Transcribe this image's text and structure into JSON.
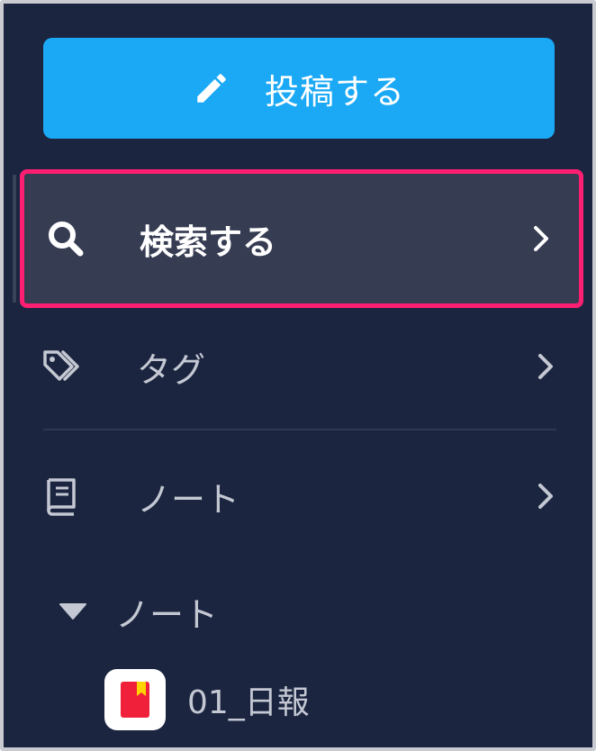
{
  "sidebar": {
    "post_button": {
      "label": "投稿する",
      "icon": "pencil-icon"
    },
    "items": [
      {
        "label": "検索する",
        "icon": "search-icon",
        "selected": true
      },
      {
        "label": "タグ",
        "icon": "tag-icon"
      },
      {
        "label": "ノート",
        "icon": "book-icon"
      }
    ],
    "notes_section": {
      "label": "ノート",
      "expanded": true,
      "entries": [
        {
          "label": "01_日報",
          "icon": "notebook-icon",
          "color": "#f0203a"
        }
      ]
    }
  },
  "colors": {
    "background": "#1b2540",
    "accent": "#1ba9f5",
    "highlight_border": "#ff1f72",
    "selected_bg": "#363c52"
  }
}
